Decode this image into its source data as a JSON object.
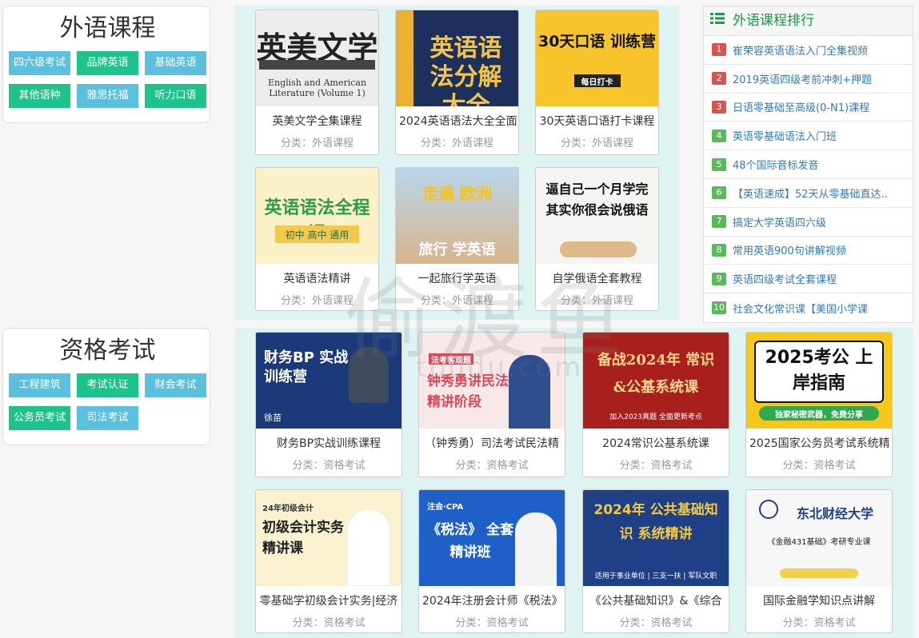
{
  "sections": [
    {
      "title": "外语课程",
      "tags": [
        {
          "label": "四六级考试",
          "color": "blue"
        },
        {
          "label": "品牌英语",
          "color": "green"
        },
        {
          "label": "基础英语",
          "color": "blue"
        },
        {
          "label": "其他语种",
          "color": "green"
        },
        {
          "label": "雅思托福",
          "color": "blue"
        },
        {
          "label": "听力口语",
          "color": "green"
        }
      ]
    },
    {
      "title": "资格考试",
      "tags": [
        {
          "label": "工程建筑",
          "color": "blue"
        },
        {
          "label": "考试认证",
          "color": "green"
        },
        {
          "label": "财会考试",
          "color": "blue"
        },
        {
          "label": "公务员考试",
          "color": "green"
        },
        {
          "label": "司法考试",
          "color": "blue"
        }
      ]
    }
  ],
  "foreign_courses": [
    {
      "title": "英美文学全集课程",
      "category": "分类：外语课程",
      "thumb_text": "英美文学",
      "thumb_sub": "English and American Literature (Volume 1)"
    },
    {
      "title": "2024英语语法大全全面",
      "category": "分类：外语课程",
      "thumb_text": "英语语法分解大全",
      "thumb_sub": ""
    },
    {
      "title": "30天英语口语打卡课程",
      "category": "分类：外语课程",
      "thumb_text": "30天口语 训练营",
      "thumb_sub": "每日打卡"
    },
    {
      "title": "英语语法精讲",
      "category": "分类：外语课程",
      "thumb_text": "英语语法全程课",
      "thumb_sub": "初中 高中 通用"
    },
    {
      "title": "一起旅行学英语",
      "category": "分类：外语课程",
      "thumb_text": "走遍 欧洲",
      "thumb_sub": "旅行 学英语"
    },
    {
      "title": "自学俄语全套教程",
      "category": "分类：外语课程",
      "thumb_text": "逼自己一个月学完 其实你很会说俄语",
      "thumb_sub": ""
    }
  ],
  "exam_courses": [
    {
      "title": "财务BP实战训练课程",
      "category": "分类：资格考试",
      "thumb_text": "财务BP 实战训练营",
      "thumb_sub": "徐苗"
    },
    {
      "title": "（钟秀勇）司法考试民法精",
      "category": "分类：资格考试",
      "thumb_text": "钟秀勇讲民法 精讲阶段",
      "thumb_sub": "法考客观题"
    },
    {
      "title": "2024常识公基系统课",
      "category": "分类：资格考试",
      "thumb_text": "备战2024年 常识&公基系统课",
      "thumb_sub": "加入2023真题 全面更新考点"
    },
    {
      "title": "2025国家公务员考试系统精",
      "category": "分类：资格考试",
      "thumb_text": "2025考公 上岸指南",
      "thumb_sub": "独家秘密武器，免费分享"
    },
    {
      "title": "零基础学初级会计实务|经济",
      "category": "分类：资格考试",
      "thumb_text": "初级会计实务 精讲课",
      "thumb_sub": "24年初级会计"
    },
    {
      "title": "2024年注册会计师《税法》",
      "category": "分类：资格考试",
      "thumb_text": "《税法》 全套精讲班",
      "thumb_sub": "注会·CPA"
    },
    {
      "title": "《公共基础知识》&《综合",
      "category": "分类：资格考试",
      "thumb_text": "2024年 公共基础知识 系统精讲",
      "thumb_sub": "适用于事业单位 | 三支一扶 | 军队文职"
    },
    {
      "title": "国际金融学知识点讲解",
      "category": "分类：资格考试",
      "thumb_text": "东北财经大学",
      "thumb_sub": "《金融431基础》考研专业课"
    }
  ],
  "ranking": {
    "title": "外语课程排行",
    "items": [
      {
        "num": "1",
        "text": "崔荣容英语语法入门全集视频",
        "color": "red"
      },
      {
        "num": "2",
        "text": "2019英语四级考前冲刺+押题",
        "color": "red"
      },
      {
        "num": "3",
        "text": "日语零基础至高级(0-N1)课程",
        "color": "red"
      },
      {
        "num": "4",
        "text": "英语零基础语法入门班",
        "color": "green"
      },
      {
        "num": "5",
        "text": "48个国际音标发音",
        "color": "green"
      },
      {
        "num": "6",
        "text": "【英语速成】52天从零基础直达..",
        "color": "green"
      },
      {
        "num": "7",
        "text": "搞定大学英语四六级",
        "color": "green"
      },
      {
        "num": "8",
        "text": "常用英语900句讲解视频",
        "color": "green"
      },
      {
        "num": "9",
        "text": "英语四级考试全套课程",
        "color": "green"
      },
      {
        "num": "10",
        "text": "社会文化常识课【美国小学课",
        "color": "green"
      }
    ]
  },
  "watermark": {
    "text": "偷渡鱼",
    "sub": "toudu.com"
  }
}
